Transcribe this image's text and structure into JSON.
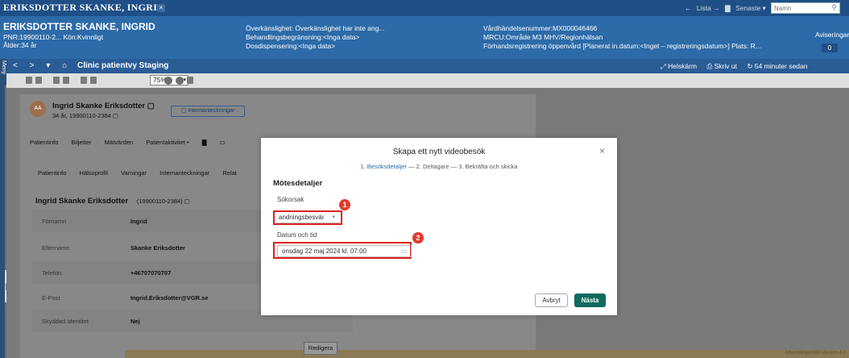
{
  "titlebar": {
    "patient_tab": "ERIKSDOTTER SKANKE, INGRID",
    "close": "×",
    "nav_back": "←",
    "lista": "Lista →",
    "folder": "▇",
    "senaste": "Senaste ▾",
    "search_placeholder": "Namn",
    "search_icon": "⚲"
  },
  "patient_header": {
    "name": "ERIKSDOTTER SKANKE, INGRID",
    "pnr": "PNR:19900110-2... Kön:Kvinnligt",
    "age": "Ålder:34 år",
    "col2": [
      "Överkänslighet: Överkänslighet har inte ang...",
      "Behandlingsbegränsning:<Inga data>",
      "Dosdispensering:<Inga data>"
    ],
    "col3": [
      "Vårdhändelsenummer:MX000046466",
      "MRCU:Område M3 MHV/Regionhälsan",
      "Förhandsregistrering öppenvård [Planerat in.datum:<Inget – registreringsdatum>] Plats: R..."
    ],
    "avis": "Aviseringar",
    "bell_count": "0"
  },
  "side": {
    "meny": "Meny",
    "grip": "|||"
  },
  "navbar": {
    "back": "<",
    "forward": ">",
    "dropdown": "▾",
    "home": "⌂",
    "title": "Clinic patientvy Staging",
    "helskarm": "⤢ Helskärm",
    "skriv_ut": "⎙ Skriv ut",
    "refresh": "↻ 54 minuter sedan"
  },
  "toolbar": {
    "zoom": "75%",
    "zoom_dd": "▾"
  },
  "patient_card": {
    "avatar": "AA",
    "name": "Ingrid Skanke Eriksdotter",
    "name_icon": "▢",
    "sub": "34 år, 19900110-2384 ▢",
    "badge": "▢ Internanteckningar",
    "tabs1": [
      "Patientinfo",
      "Biljetter",
      "Mätvärden",
      "Patientaktivitet •",
      "▇",
      "▭"
    ],
    "tabs2": [
      "Patientinfo",
      "Hälsoprofil",
      "Varningar",
      "Internanteckningar",
      "Relat"
    ],
    "info_title": "Ingrid Skanke Eriksdotter",
    "info_title_pnr": "(19900110-2384) ▢",
    "rows": [
      {
        "label": "Förnamn",
        "value": "Ingrid"
      },
      {
        "label": "Efternamn",
        "value": "Skanke Eriksdotter"
      },
      {
        "label": "Telefon",
        "value": "+46707070707"
      },
      {
        "label": "E-Post",
        "value": "Ingrid.Eriksdotter@VGR.se"
      },
      {
        "label": "Skyddad Identitet",
        "value": "Nej"
      }
    ],
    "edit": "Redigera",
    "env": "Utvecklingsmiljö Version 4.2"
  },
  "modal": {
    "title": "Skapa ett nytt videobesök",
    "close": "×",
    "step1": "1. Besöksdetaljer",
    "step_rest": " — 2. Deltagare — 3. Bekräfta och skicka",
    "section": "Mötesdetaljer",
    "reason_label": "Sökorsak",
    "reason_value": "andningsbesvär",
    "reason_dd": "▾",
    "date_label": "Datum och tid",
    "date_value": "onsdag 22 maj 2024 kl. 07:00",
    "date_icon": "▭",
    "marker1": "1",
    "marker2": "2",
    "cancel": "Avbryt",
    "next": "Nästa"
  }
}
